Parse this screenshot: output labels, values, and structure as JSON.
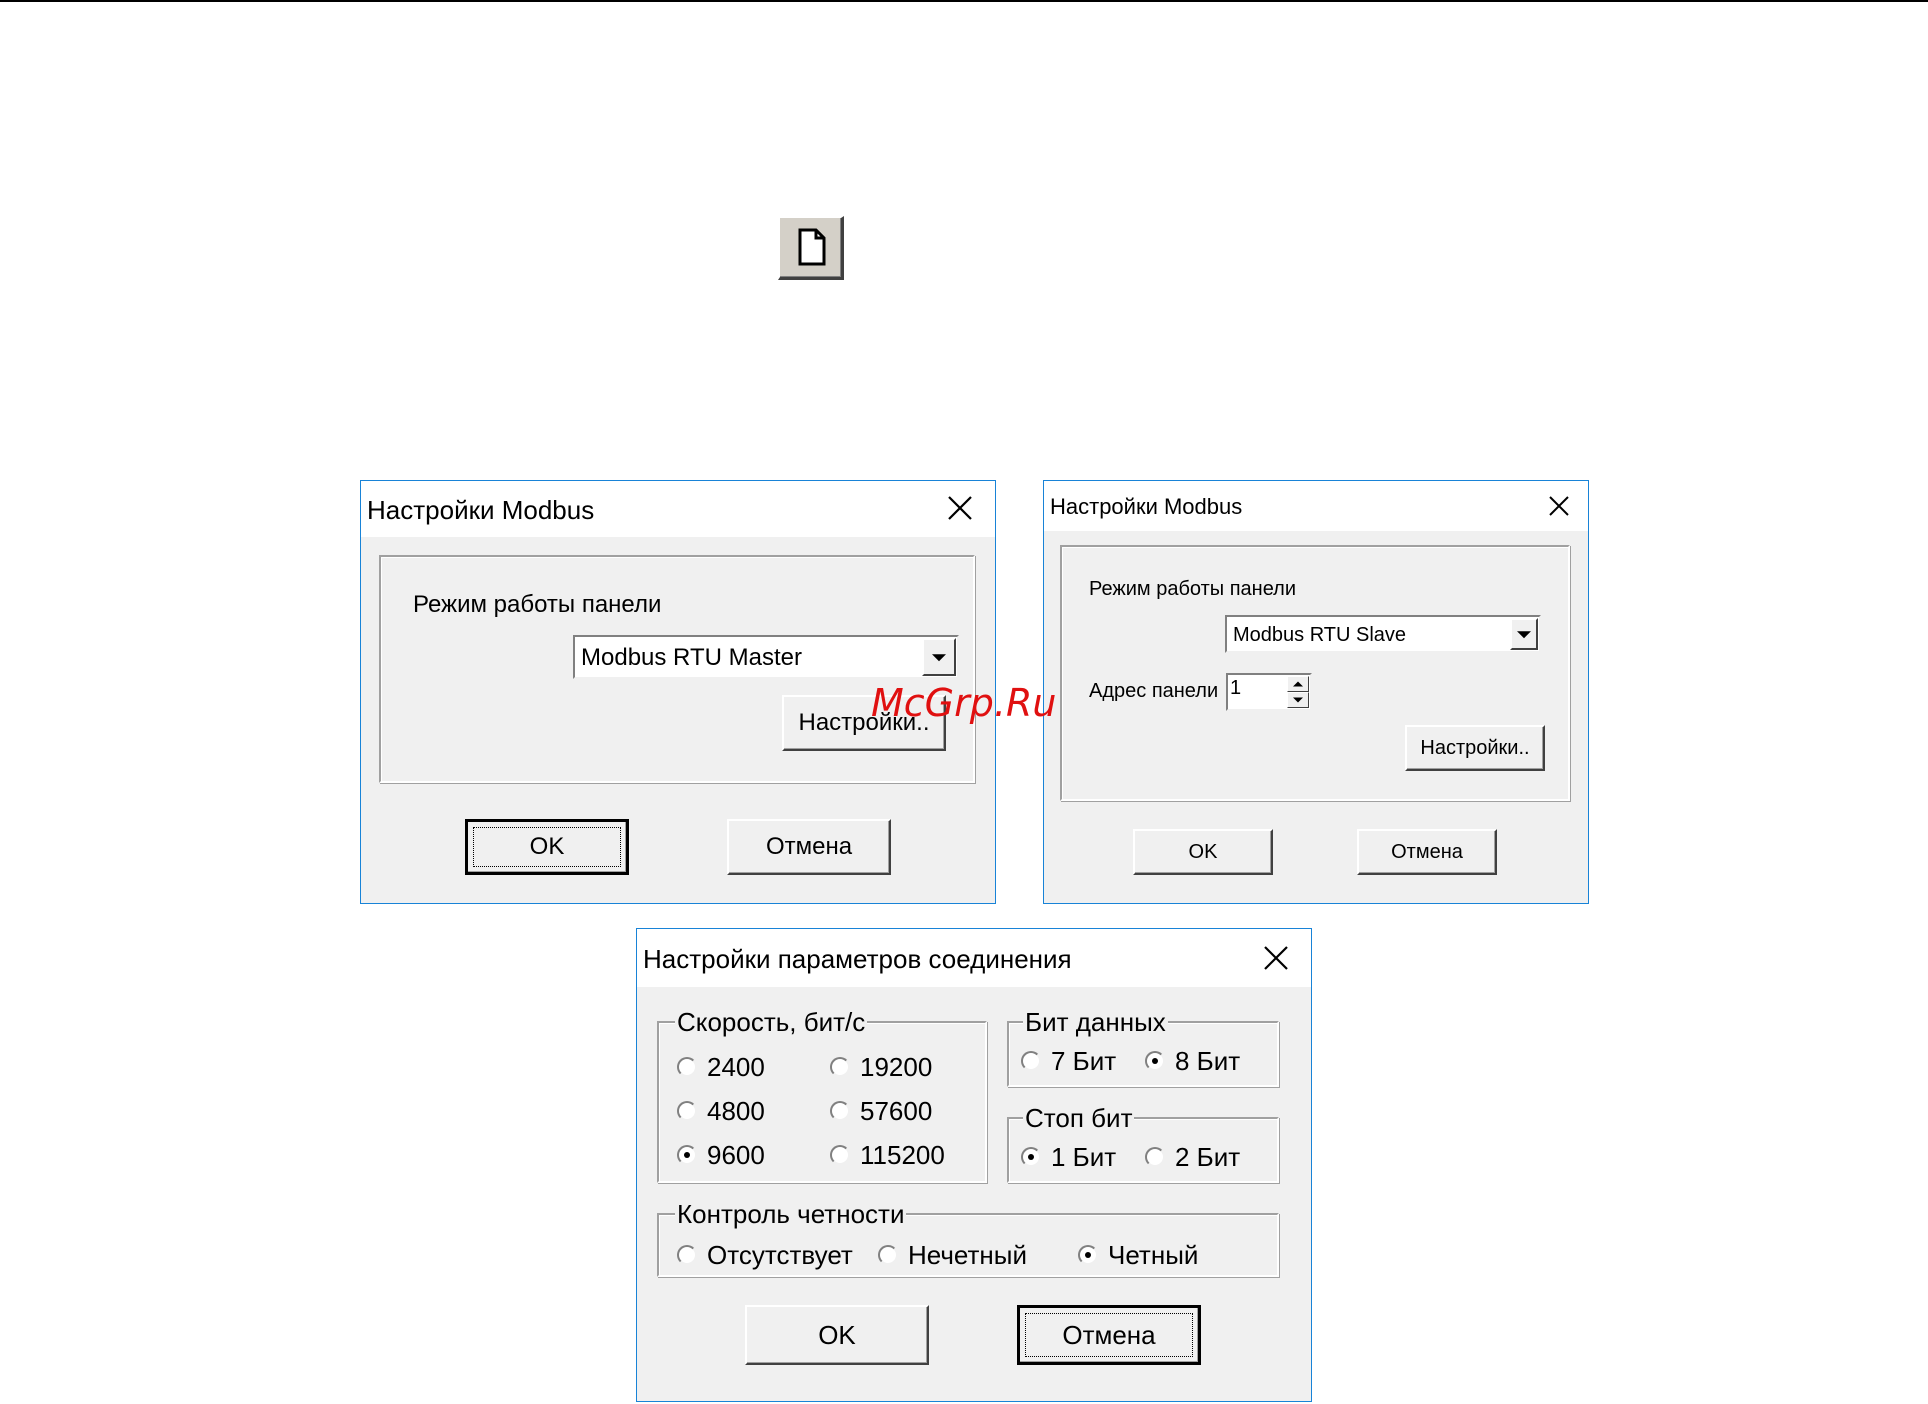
{
  "toolbar": {
    "new_icon": "new-document-icon"
  },
  "master_dialog": {
    "title": "Настройки Modbus",
    "mode_label": "Режим работы панели",
    "mode_value": "Modbus RTU Master",
    "settings_button": "Настройки..",
    "ok_button": "OK",
    "cancel_button": "Отмена"
  },
  "slave_dialog": {
    "title": "Настройки Modbus",
    "mode_label": "Режим работы панели",
    "mode_value": "Modbus RTU Slave",
    "address_label": "Адрес панели",
    "address_value": "1",
    "settings_button": "Настройки..",
    "ok_button": "OK",
    "cancel_button": "Отмена"
  },
  "connection_dialog": {
    "title": "Настройки параметров соединения",
    "speed_group": {
      "label": "Скорость, бит/с",
      "options": [
        "2400",
        "19200",
        "4800",
        "57600",
        "9600",
        "115200"
      ],
      "selected": "9600"
    },
    "data_bits_group": {
      "label": "Бит данных",
      "options": [
        "7 Бит",
        "8 Бит"
      ],
      "selected": "8 Бит"
    },
    "stop_bits_group": {
      "label": "Стоп бит",
      "options": [
        "1 Бит",
        "2 Бит"
      ],
      "selected": "1 Бит"
    },
    "parity_group": {
      "label": "Контроль четности",
      "options": [
        "Отсутствует",
        "Нечетный",
        "Четный"
      ],
      "selected": "Четный"
    },
    "ok_button": "OK",
    "cancel_button": "Отмена"
  },
  "watermark": "McGrp.Ru",
  "colors": {
    "dialog_border": "#1883d7",
    "dialog_bg": "#f0f0f0",
    "watermark": "#e01010"
  }
}
